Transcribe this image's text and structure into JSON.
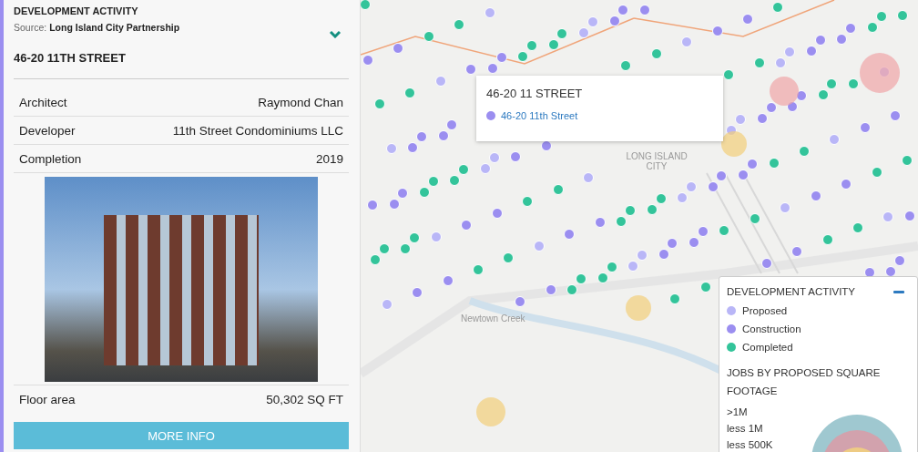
{
  "panel": {
    "heading": "DEVELOPMENT ACTIVITY",
    "source_label": "Source:",
    "source": "Long Island City Partnership",
    "title": "46-20 11TH STREET",
    "rows": [
      {
        "label": "Architect",
        "value": "Raymond Chan"
      },
      {
        "label": "Developer",
        "value": "11th Street Condominiums LLC"
      },
      {
        "label": "Completion",
        "value": "2019"
      }
    ],
    "floor_row": {
      "label": "Floor area",
      "value": "50,302 SQ FT"
    },
    "button": "MORE INFO"
  },
  "map": {
    "labels": [
      "LONG ISLAND CITY",
      "Newtown Creek"
    ],
    "popup": {
      "title": "46-20 11 STREET",
      "link": "46-20 11th Street",
      "color": "#9b8ef0"
    },
    "legend": {
      "title": "DEVELOPMENT ACTIVITY",
      "items": [
        {
          "label": "Proposed",
          "color": "#b9b6f7"
        },
        {
          "label": "Construction",
          "color": "#9b8ef0"
        },
        {
          "label": "Completed",
          "color": "#33c49a"
        }
      ],
      "size_title": "JOBS BY PROPOSED SQUARE FOOTAGE",
      "sizes": [
        ">1M",
        "less 1M",
        "less 500K"
      ]
    }
  }
}
